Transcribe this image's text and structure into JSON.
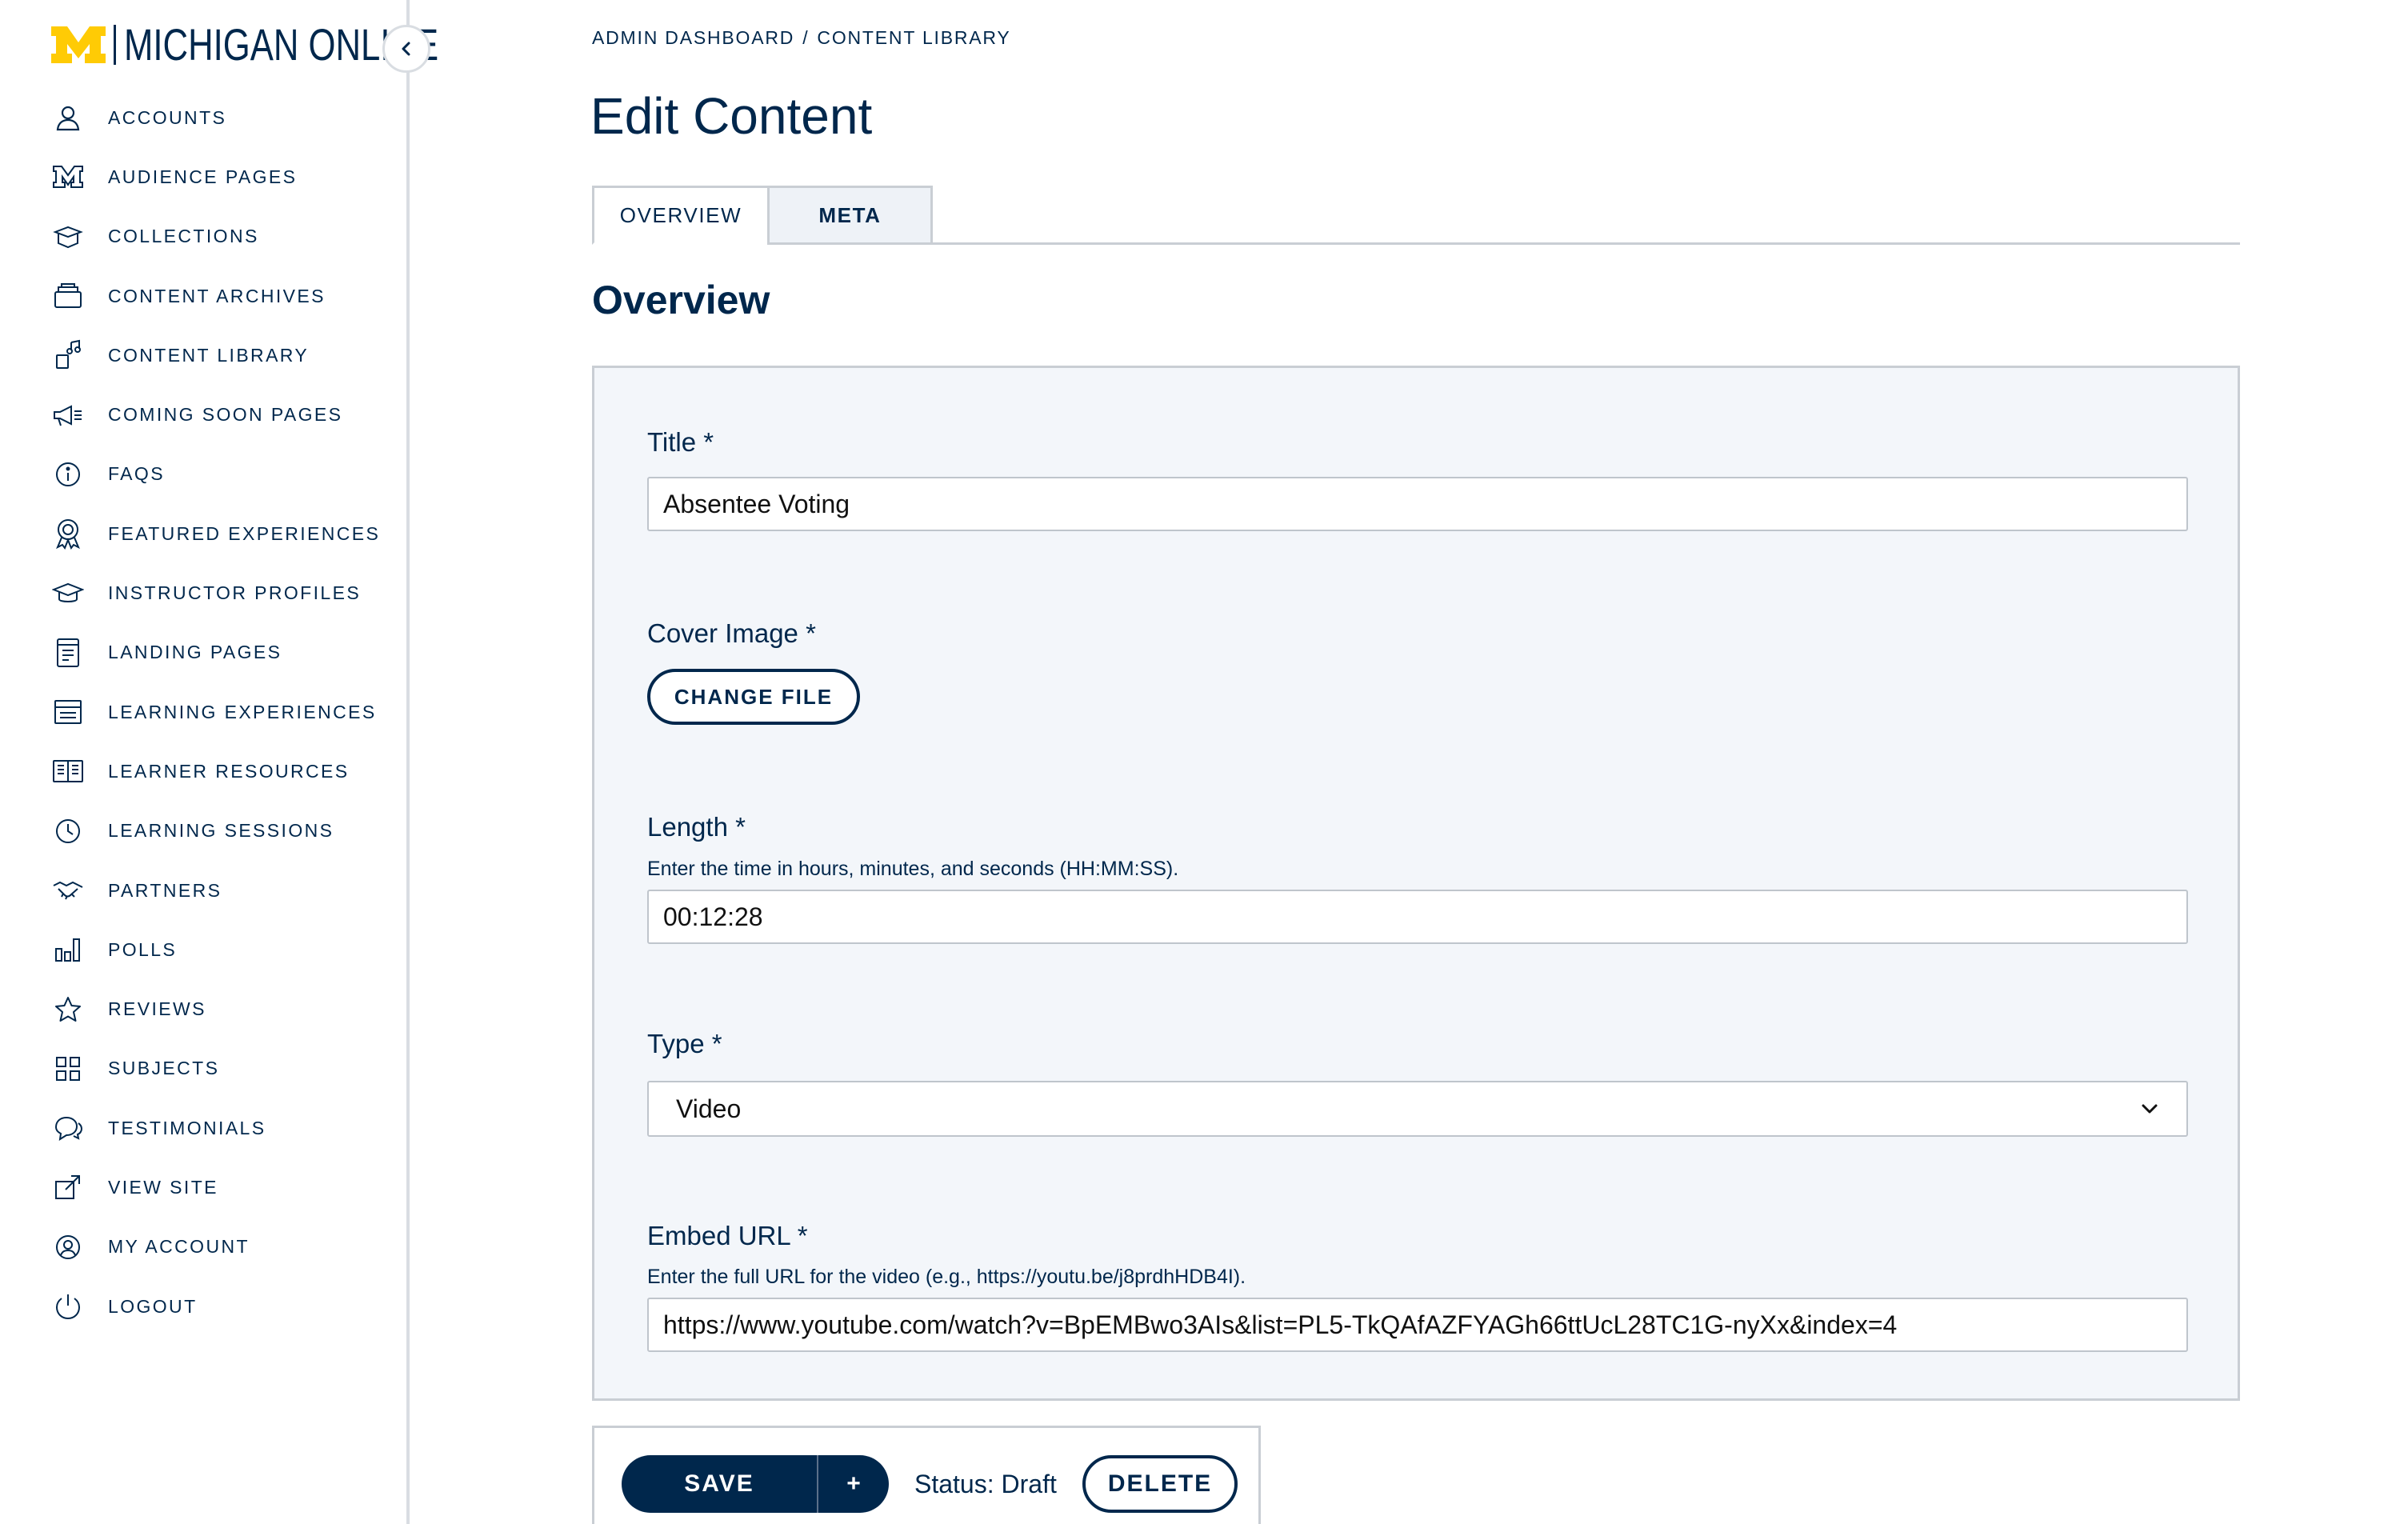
{
  "brand": {
    "name": "MICHIGAN ONLINE",
    "maize": "#ffcb05",
    "blue": "#00274c"
  },
  "sidebar": {
    "items": [
      {
        "label": "ACCOUNTS",
        "icon": "user-icon"
      },
      {
        "label": "AUDIENCE PAGES",
        "icon": "block-m-icon"
      },
      {
        "label": "COLLECTIONS",
        "icon": "box-icon"
      },
      {
        "label": "CONTENT ARCHIVES",
        "icon": "archive-icon"
      },
      {
        "label": "CONTENT LIBRARY",
        "icon": "media-library-icon"
      },
      {
        "label": "COMING SOON PAGES",
        "icon": "megaphone-icon"
      },
      {
        "label": "FAQS",
        "icon": "info-icon"
      },
      {
        "label": "FEATURED EXPERIENCES",
        "icon": "award-icon"
      },
      {
        "label": "INSTRUCTOR PROFILES",
        "icon": "graduation-cap-icon"
      },
      {
        "label": "LANDING PAGES",
        "icon": "document-icon"
      },
      {
        "label": "LEARNING EXPERIENCES",
        "icon": "list-window-icon"
      },
      {
        "label": "LEARNER RESOURCES",
        "icon": "book-icon"
      },
      {
        "label": "LEARNING SESSIONS",
        "icon": "clock-icon"
      },
      {
        "label": "PARTNERS",
        "icon": "handshake-icon"
      },
      {
        "label": "POLLS",
        "icon": "bar-chart-icon"
      },
      {
        "label": "REVIEWS",
        "icon": "star-icon"
      },
      {
        "label": "SUBJECTS",
        "icon": "grid-icon"
      },
      {
        "label": "TESTIMONIALS",
        "icon": "chat-bubbles-icon"
      },
      {
        "label": "VIEW SITE",
        "icon": "external-link-icon"
      },
      {
        "label": "MY ACCOUNT",
        "icon": "account-circle-icon"
      },
      {
        "label": "LOGOUT",
        "icon": "power-icon"
      }
    ]
  },
  "breadcrumb": {
    "root": "ADMIN DASHBOARD",
    "separator": "/",
    "current": "CONTENT LIBRARY"
  },
  "page": {
    "title": "Edit Content"
  },
  "tabs": [
    {
      "label": "OVERVIEW",
      "active": true
    },
    {
      "label": "META",
      "active": false
    }
  ],
  "section": {
    "title": "Overview"
  },
  "form": {
    "title": {
      "label": "Title *",
      "value": "Absentee Voting"
    },
    "cover_image": {
      "label": "Cover Image *",
      "button": "CHANGE FILE"
    },
    "length": {
      "label": "Length *",
      "help": "Enter the time in hours, minutes, and seconds (HH:MM:SS).",
      "value": "00:12:28"
    },
    "type": {
      "label": "Type *",
      "selected": "Video"
    },
    "embed_url": {
      "label": "Embed URL *",
      "help": "Enter the full URL for the video (e.g., https://youtu.be/j8prdhHDB4I).",
      "value": "https://www.youtube.com/watch?v=BpEMBwo3AIs&list=PL5-TkQAfAZFYAGh66ttUcL28TC1G-nyXx&index=4"
    }
  },
  "actions": {
    "save": "SAVE",
    "save_more": "+",
    "status": "Status: Draft",
    "delete": "DELETE"
  }
}
